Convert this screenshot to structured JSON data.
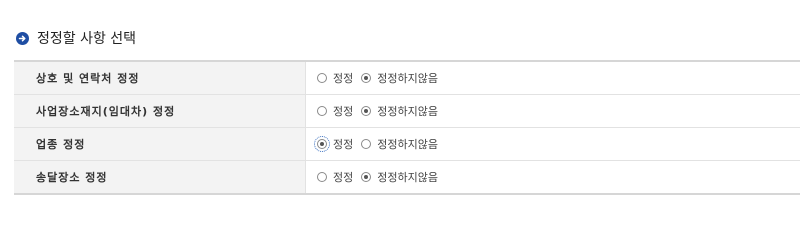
{
  "section": {
    "title": "정정할 사항 선택",
    "icon": "arrow-circle-icon",
    "accent_color": "#1f4ea3"
  },
  "options": {
    "correct": "정정",
    "no_correct": "정정하지않음"
  },
  "rows": [
    {
      "label": "상호 및 연락처 정정",
      "selected": "no_correct"
    },
    {
      "label": "사업장소재지(임대차) 정정",
      "selected": "no_correct"
    },
    {
      "label": "업종 정정",
      "selected": "correct",
      "focused": true
    },
    {
      "label": "송달장소 정정",
      "selected": "no_correct"
    }
  ]
}
